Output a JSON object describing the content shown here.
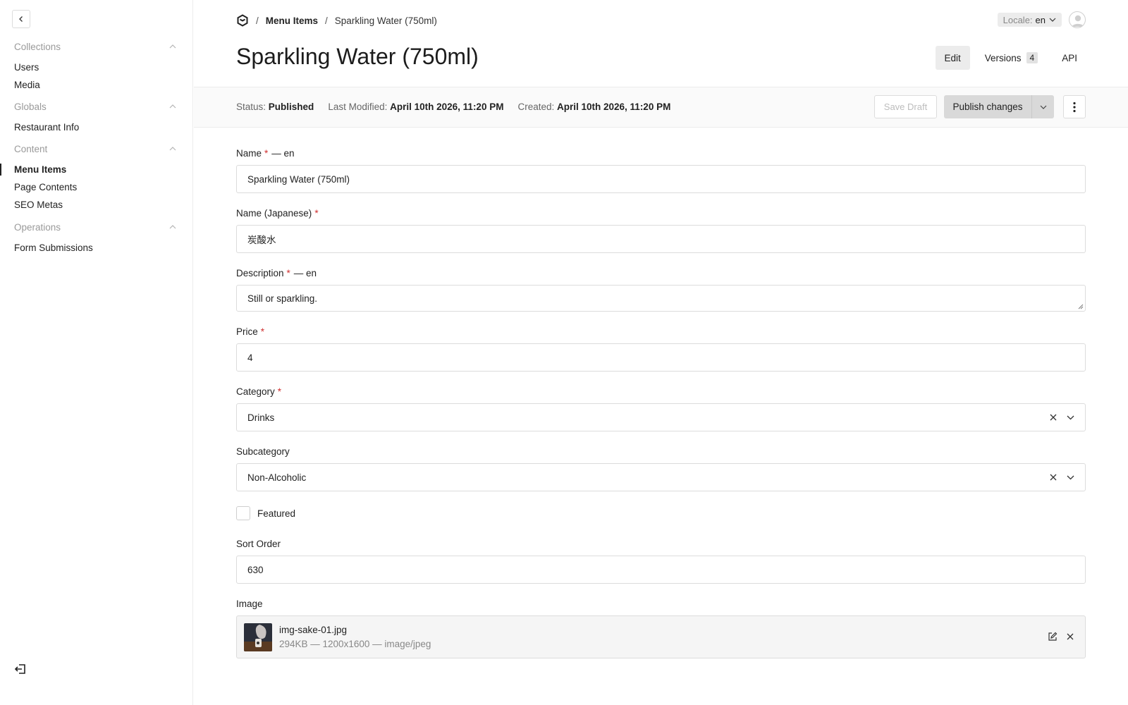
{
  "sidebar": {
    "groups": [
      {
        "label": "Collections",
        "items": [
          "Users",
          "Media"
        ]
      },
      {
        "label": "Globals",
        "items": [
          "Restaurant Info"
        ]
      },
      {
        "label": "Content",
        "items": [
          "Menu Items",
          "Page Contents",
          "SEO Metas"
        ]
      },
      {
        "label": "Operations",
        "items": [
          "Form Submissions"
        ]
      }
    ],
    "active_item": "Menu Items"
  },
  "breadcrumb": {
    "separator": "/",
    "collection": "Menu Items",
    "current": "Sparkling Water (750ml)"
  },
  "locale": {
    "label": "Locale:",
    "value": "en"
  },
  "page_title": "Sparkling Water (750ml)",
  "tabs": [
    {
      "label": "Edit"
    },
    {
      "label": "Versions",
      "count": "4"
    },
    {
      "label": "API"
    }
  ],
  "status_bar": {
    "status_label": "Status:",
    "status_value": "Published",
    "modified_label": "Last Modified:",
    "modified_value": "April 10th 2026, 11:20 PM",
    "created_label": "Created:",
    "created_value": "April 10th 2026, 11:20 PM",
    "save_draft": "Save Draft",
    "publish": "Publish changes"
  },
  "fields": {
    "name": {
      "label": "Name",
      "required": "*",
      "suffix": "— en",
      "value": "Sparkling Water (750ml)"
    },
    "name_ja": {
      "label": "Name (Japanese)",
      "required": "*",
      "value": "炭酸水"
    },
    "description": {
      "label": "Description",
      "required": "*",
      "suffix": "— en",
      "value": "Still or sparkling."
    },
    "price": {
      "label": "Price",
      "required": "*",
      "value": "4"
    },
    "category": {
      "label": "Category",
      "required": "*",
      "value": "Drinks"
    },
    "subcategory": {
      "label": "Subcategory",
      "value": "Non-Alcoholic"
    },
    "featured": {
      "label": "Featured",
      "checked": false
    },
    "sort_order": {
      "label": "Sort Order",
      "value": "630"
    },
    "image": {
      "label": "Image",
      "filename": "img-sake-01.jpg",
      "meta": "294KB — 1200x1600 — image/jpeg"
    }
  }
}
